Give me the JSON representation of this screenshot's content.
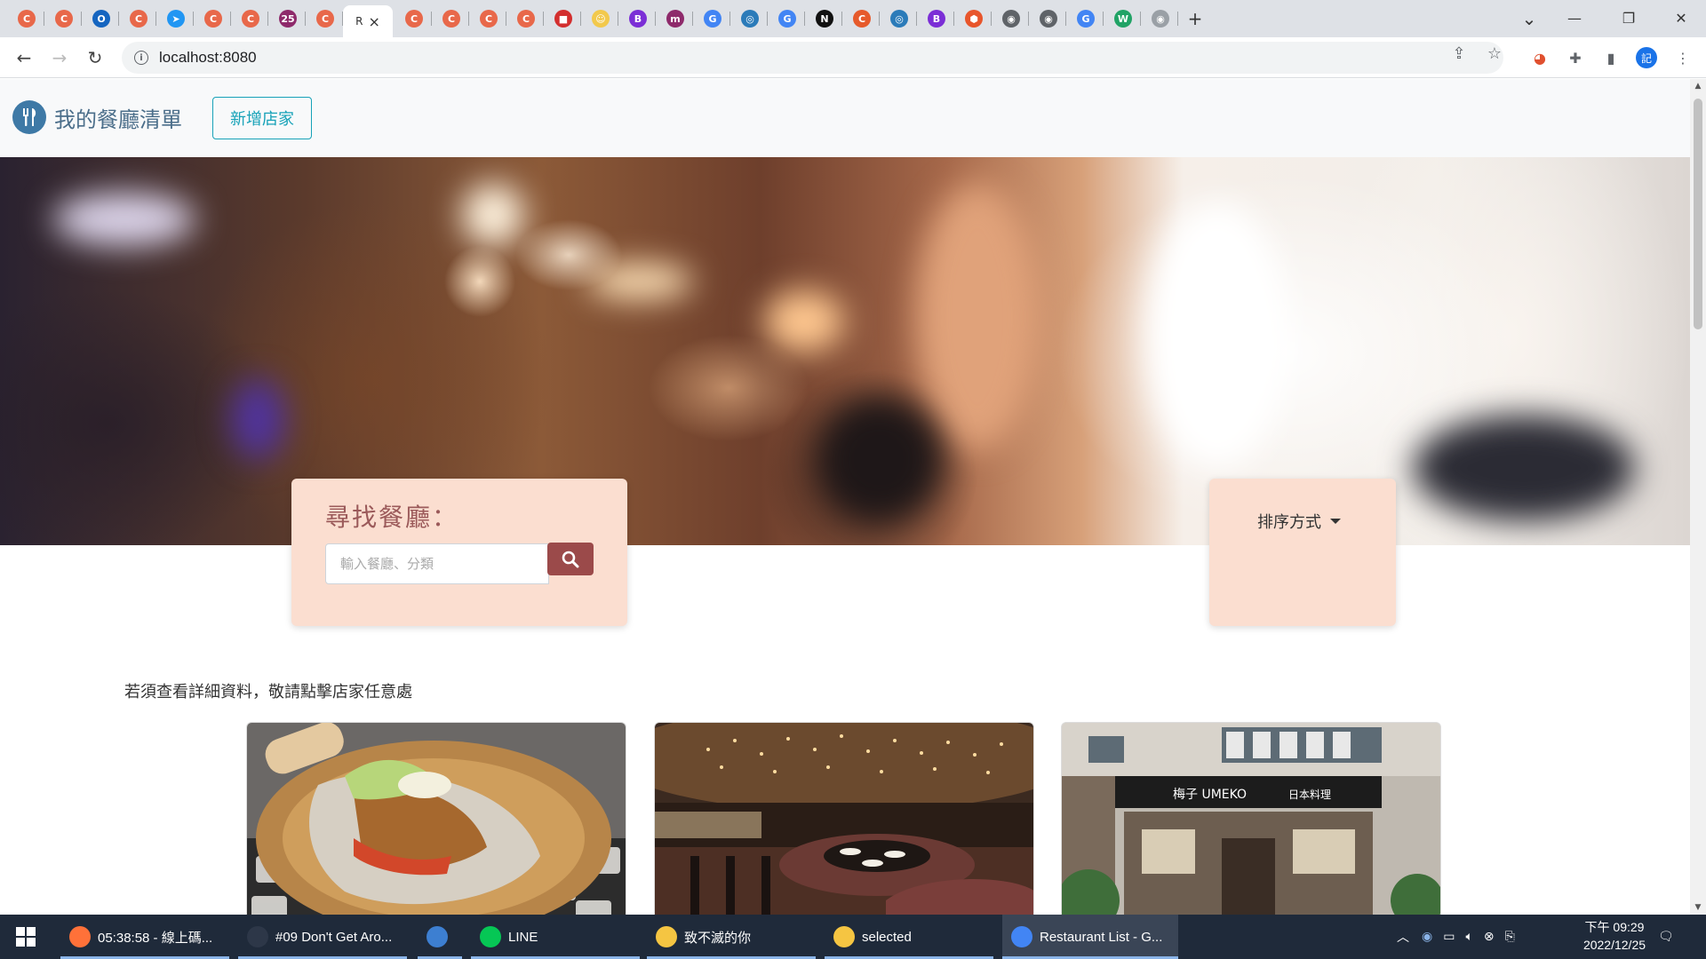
{
  "browser": {
    "tabs": [
      {
        "icon": "red-swirl-icon",
        "color": "#e8684a",
        "glyph": "C"
      },
      {
        "icon": "red-swirl-icon",
        "color": "#e8684a",
        "glyph": "C"
      },
      {
        "icon": "circle-target-icon",
        "color": "#1565c0",
        "glyph": "O"
      },
      {
        "icon": "red-swirl-icon",
        "color": "#e8684a",
        "glyph": "C"
      },
      {
        "icon": "paper-plane-icon",
        "color": "#2196f3",
        "glyph": "➤"
      },
      {
        "icon": "red-swirl-icon",
        "color": "#e8684a",
        "glyph": "C"
      },
      {
        "icon": "red-swirl-icon",
        "color": "#e8684a",
        "glyph": "C"
      },
      {
        "icon": "badge-25-icon",
        "color": "#8e2a6b",
        "glyph": "25"
      },
      {
        "icon": "red-swirl-icon",
        "color": "#e8684a",
        "glyph": "C"
      }
    ],
    "active_tab": {
      "title": "R",
      "close": "×"
    },
    "tabs_right": [
      {
        "icon": "red-swirl-icon",
        "color": "#e8684a",
        "glyph": "C"
      },
      {
        "icon": "red-swirl-icon",
        "color": "#e8684a",
        "glyph": "C"
      },
      {
        "icon": "red-swirl-icon",
        "color": "#e8684a",
        "glyph": "C"
      },
      {
        "icon": "red-swirl-icon",
        "color": "#e8684a",
        "glyph": "C"
      },
      {
        "icon": "red-square-icon",
        "color": "#d32f2f",
        "glyph": "■"
      },
      {
        "icon": "yellow-face-icon",
        "color": "#f2c94c",
        "glyph": "☺"
      },
      {
        "icon": "bootstrap-icon",
        "color": "#7b2ed6",
        "glyph": "B"
      },
      {
        "icon": "m-logo-icon",
        "color": "#8e2a6b",
        "glyph": "m"
      },
      {
        "icon": "google-icon",
        "color": "#4285f4",
        "glyph": "G"
      },
      {
        "icon": "globe-icon",
        "color": "#2b7bb9",
        "glyph": "◎"
      },
      {
        "icon": "google-icon",
        "color": "#4285f4",
        "glyph": "G"
      },
      {
        "icon": "notion-icon",
        "color": "#111111",
        "glyph": "N"
      },
      {
        "icon": "c-logo-icon",
        "color": "#e65a2b",
        "glyph": "C"
      },
      {
        "icon": "globe-icon",
        "color": "#2b7bb9",
        "glyph": "◎"
      },
      {
        "icon": "bootstrap-icon",
        "color": "#7b2ed6",
        "glyph": "B"
      },
      {
        "icon": "hexagon-icon",
        "color": "#e8552b",
        "glyph": "⬢"
      },
      {
        "icon": "gray-circle-icon",
        "color": "#5f6368",
        "glyph": "◉"
      },
      {
        "icon": "gray-circle-icon",
        "color": "#5f6368",
        "glyph": "◉"
      },
      {
        "icon": "google-icon",
        "color": "#4285f4",
        "glyph": "G"
      },
      {
        "icon": "w-logo-icon",
        "color": "#21a366",
        "glyph": "W"
      },
      {
        "icon": "gray-circle-icon",
        "color": "#9aa0a6",
        "glyph": "◉"
      }
    ],
    "new_tab": "+",
    "url": "localhost:8080",
    "profile_initial": "記"
  },
  "page": {
    "brand": "我的餐廳清單",
    "new_button": "新增店家",
    "search": {
      "title": "尋找餐廳：",
      "placeholder": "輸入餐廳、分類"
    },
    "sort_label": "排序方式",
    "hint": "若須查看詳細資料，敬請點擊店家任意處"
  },
  "taskbar": {
    "items": [
      {
        "label": "05:38:58 - 線上碼...",
        "icon": "firefox-icon",
        "color": "#ff7139"
      },
      {
        "label": "#09 Don't Get Aro...",
        "icon": "fox-mask-icon",
        "color": "#2d3748"
      },
      {
        "label": "",
        "icon": "qbittorrent-icon",
        "color": "#3d7fd1"
      },
      {
        "label": "LINE",
        "icon": "line-icon",
        "color": "#06c755"
      },
      {
        "label": "致不滅的你",
        "icon": "folder-icon",
        "color": "#f5c542"
      },
      {
        "label": "selected",
        "icon": "folder-icon",
        "color": "#f5c542"
      },
      {
        "label": "Restaurant List - G...",
        "icon": "chrome-icon",
        "color": "#4285f4"
      }
    ],
    "time": "下午 09:29",
    "date": "2022/12/25"
  }
}
